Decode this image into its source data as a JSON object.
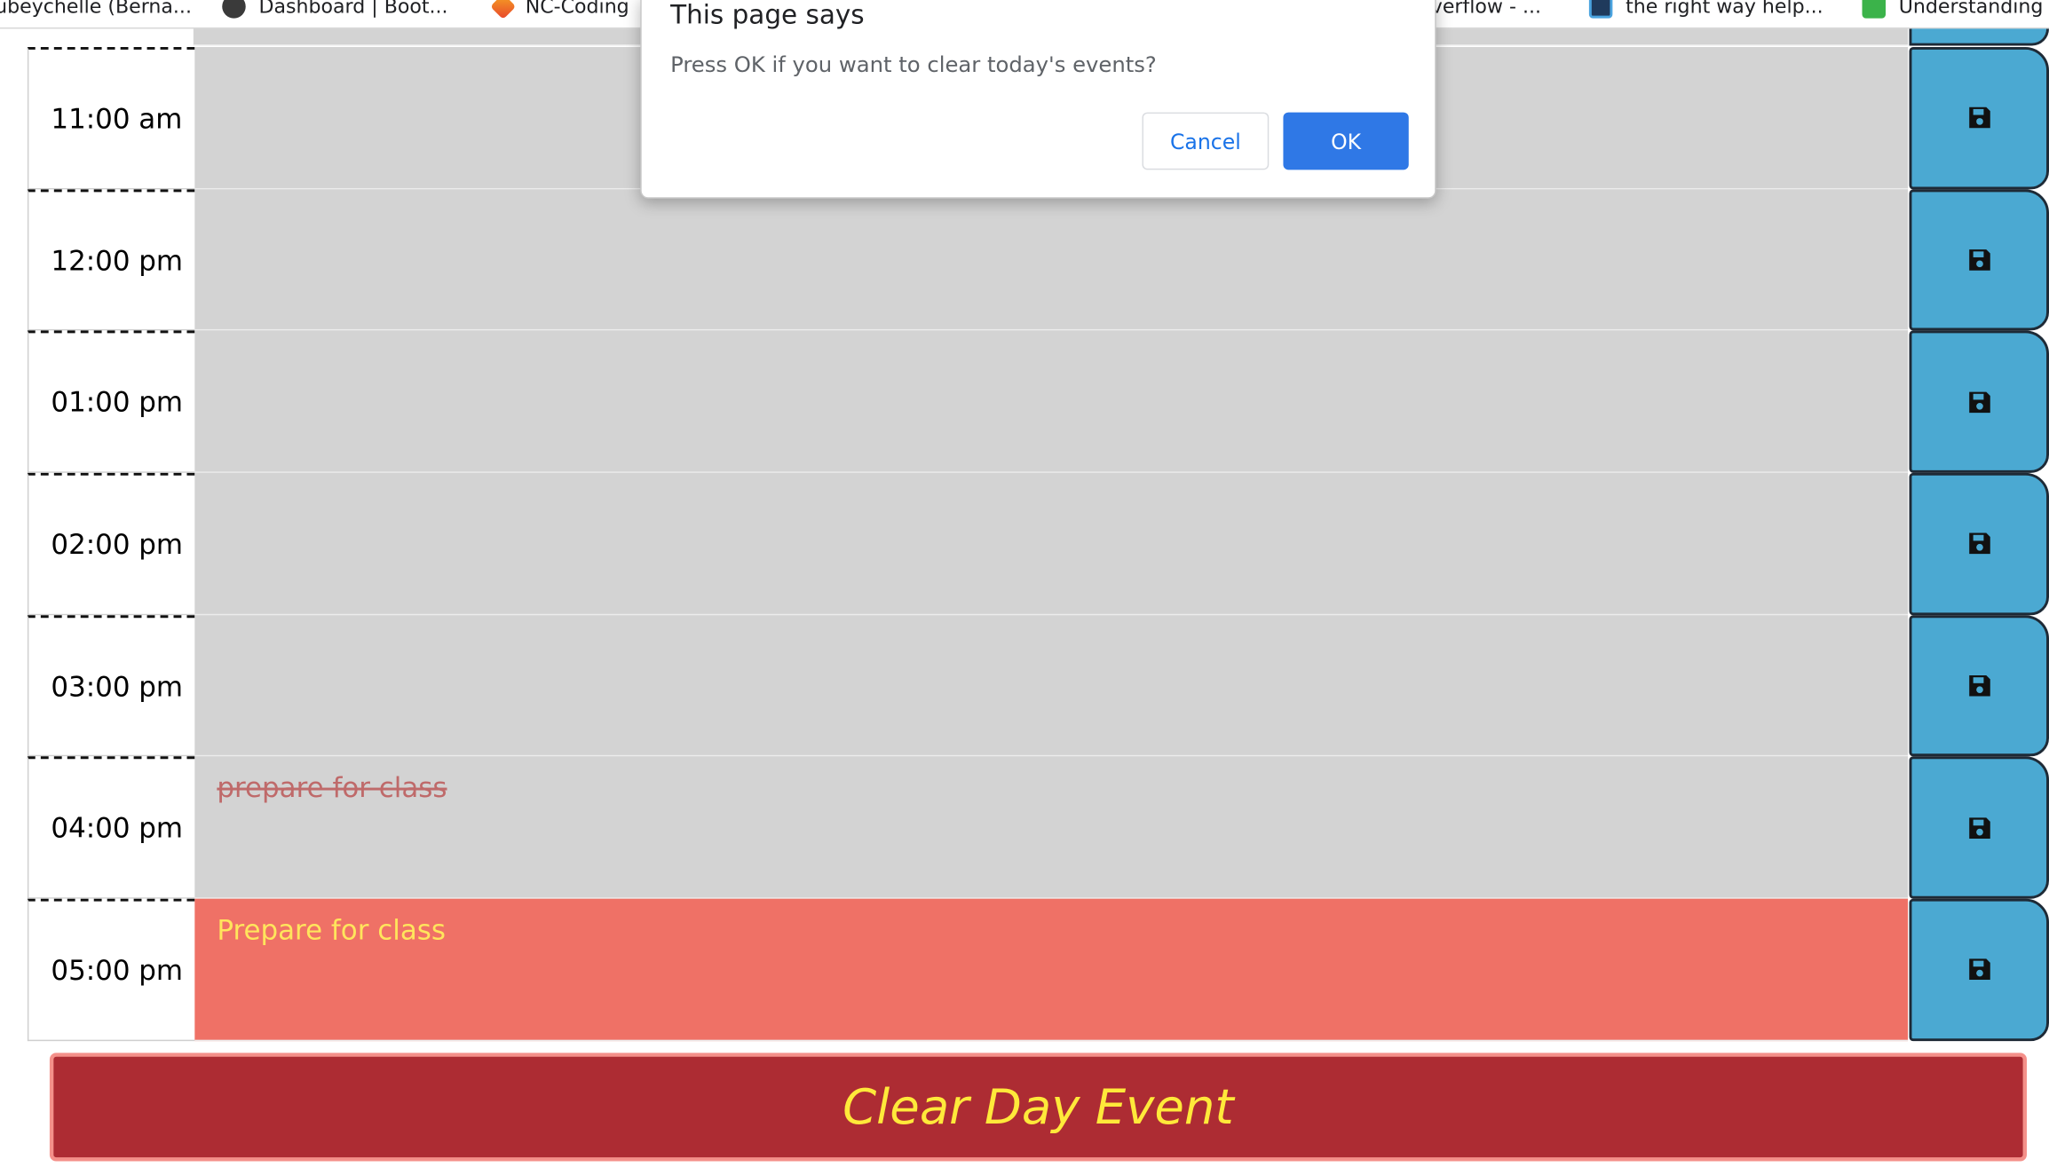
{
  "bookmarks": [
    {
      "label": "ubeychelle (Berna...",
      "icon": "bookmark-favicon"
    },
    {
      "label": "Dashboard | Boot...",
      "icon": "github-icon"
    },
    {
      "label": "NC-Coding",
      "icon": "codepen-icon"
    },
    {
      "label": "verflow - ...",
      "icon": "bookmark-favicon"
    },
    {
      "label": "the right way help...",
      "icon": "bookmark-favicon"
    },
    {
      "label": "Understanding",
      "icon": "bookmark-favicon"
    }
  ],
  "dialog": {
    "title": "This page says",
    "message": "Press OK if you want to clear today's events?",
    "cancel_label": "Cancel",
    "ok_label": "OK"
  },
  "rows": [
    {
      "hour": "11:00 am",
      "event": "",
      "state": "past"
    },
    {
      "hour": "12:00 pm",
      "event": "",
      "state": "past"
    },
    {
      "hour": "01:00 pm",
      "event": "",
      "state": "past"
    },
    {
      "hour": "02:00 pm",
      "event": "",
      "state": "past"
    },
    {
      "hour": "03:00 pm",
      "event": "",
      "state": "past"
    },
    {
      "hour": "04:00 pm",
      "event": "prepare for class",
      "state": "past"
    },
    {
      "hour": "05:00 pm",
      "event": "Prepare for class",
      "state": "present"
    }
  ],
  "save_icon": "floppy-disk-icon",
  "clear_button": {
    "label": "Clear Day Event"
  },
  "colors": {
    "past_bg": "#d3d3d3",
    "present_bg": "#ef7166",
    "save_bg": "#4ba9d2",
    "clear_bg": "#ad2c33",
    "clear_text": "#ffe93a",
    "ok_bg": "#2f78e6"
  }
}
